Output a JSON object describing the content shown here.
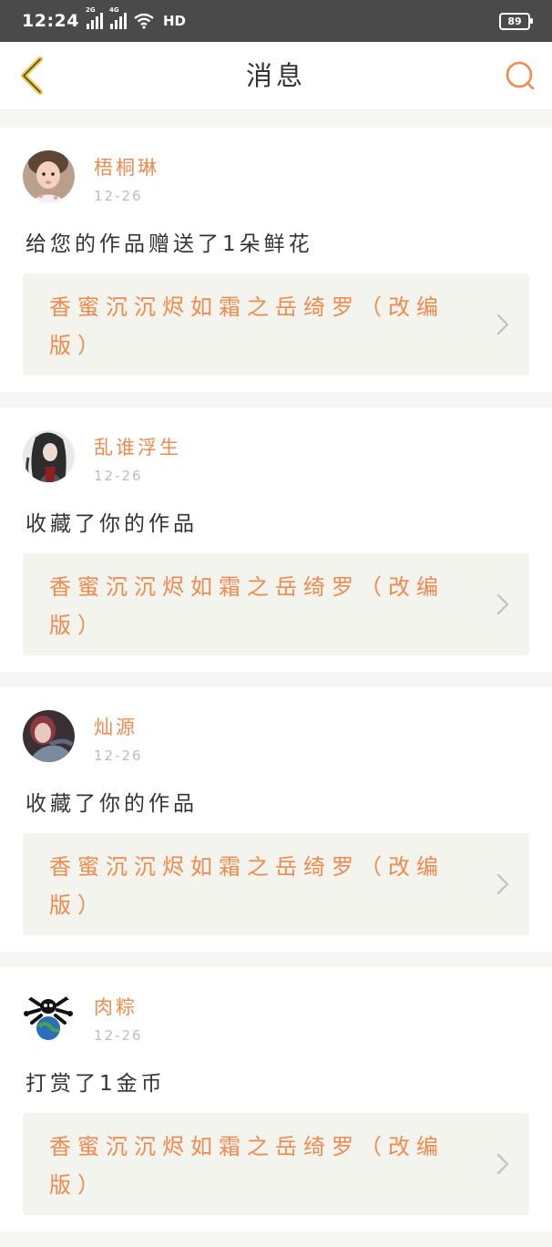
{
  "status_bar": {
    "time": "12:24",
    "signal1_tag": "2G",
    "signal2_tag": "4G",
    "network": "HD",
    "battery": "89"
  },
  "header": {
    "title": "消息",
    "back_icon": "chevron-left-icon",
    "search_icon": "search-icon"
  },
  "colors": {
    "accent": "#ef8a4e",
    "back_arrow": "#e8c84a",
    "card_bg": "#ffffff",
    "work_bg": "#f4f4ef",
    "page_bg": "#f6f6f4"
  },
  "messages": [
    {
      "sender": "梧桐琳",
      "date": "12-26",
      "action": "给您的作品赠送了1朵鲜花",
      "work_title": "香蜜沉沉烬如霜之岳绮罗（改编版）",
      "avatar_icon": "child-avatar"
    },
    {
      "sender": "乱谁浮生",
      "date": "12-26",
      "action": "收藏了你的作品",
      "work_title": "香蜜沉沉烬如霜之岳绮罗（改编版）",
      "avatar_icon": "warrior-avatar"
    },
    {
      "sender": "灿源",
      "date": "12-26",
      "action": "收藏了你的作品",
      "work_title": "香蜜沉沉烬如霜之岳绮罗（改编版）",
      "avatar_icon": "girl-avatar"
    },
    {
      "sender": "肉粽",
      "date": "12-26",
      "action": "打赏了1金币",
      "work_title": "香蜜沉沉烬如霜之岳绮罗（改编版）",
      "avatar_icon": "globe-skull-avatar"
    }
  ]
}
